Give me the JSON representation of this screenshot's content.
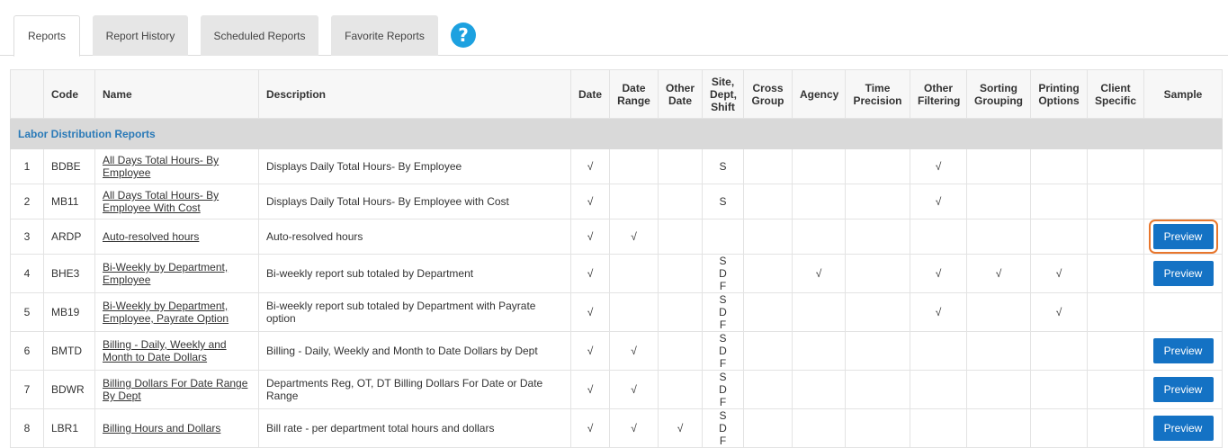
{
  "tabs": [
    {
      "label": "Reports",
      "active": true
    },
    {
      "label": "Report History"
    },
    {
      "label": "Scheduled Reports"
    },
    {
      "label": "Favorite Reports"
    }
  ],
  "help_icon": "?",
  "table": {
    "headers": {
      "num": "",
      "code": "Code",
      "name": "Name",
      "description": "Description",
      "date": "Date",
      "date_range": "Date Range",
      "other_date": "Other Date",
      "site_dept_shift": "Site, Dept, Shift",
      "cross_group": "Cross Group",
      "agency": "Agency",
      "time_precision": "Time Precision",
      "other_filtering": "Other Filtering",
      "sorting_grouping": "Sorting Grouping",
      "printing_options": "Printing Options",
      "client_specific": "Client Specific",
      "sample": "Sample"
    },
    "group_label": "Labor Distribution Reports",
    "preview_label": "Preview",
    "rows": [
      {
        "num": "1",
        "code": "BDBE",
        "name": "All Days Total Hours- By Employee",
        "description": "Displays Daily Total Hours- By Employee",
        "date": "√",
        "date_range": "",
        "other_date": "",
        "sds": "S",
        "cross_group": "",
        "agency": "",
        "time_precision": "",
        "other_filtering": "√",
        "sorting_grouping": "",
        "printing_options": "",
        "client_specific": "",
        "preview": false
      },
      {
        "num": "2",
        "code": "MB11",
        "name": "All Days Total Hours- By Employee With Cost",
        "description": "Displays Daily Total Hours- By Employee with Cost",
        "date": "√",
        "date_range": "",
        "other_date": "",
        "sds": "S",
        "cross_group": "",
        "agency": "",
        "time_precision": "",
        "other_filtering": "√",
        "sorting_grouping": "",
        "printing_options": "",
        "client_specific": "",
        "preview": false
      },
      {
        "num": "3",
        "code": "ARDP",
        "name": "Auto-resolved hours",
        "description": "Auto-resolved hours",
        "date": "√",
        "date_range": "√",
        "other_date": "",
        "sds": "",
        "cross_group": "",
        "agency": "",
        "time_precision": "",
        "other_filtering": "",
        "sorting_grouping": "",
        "printing_options": "",
        "client_specific": "",
        "preview": true,
        "focused": true
      },
      {
        "num": "4",
        "code": "BHE3",
        "name": "Bi-Weekly by Department, Employee",
        "description": "Bi-weekly report sub totaled by Department",
        "date": "√",
        "date_range": "",
        "other_date": "",
        "sds": "S D F",
        "cross_group": "",
        "agency": "√",
        "time_precision": "",
        "other_filtering": "√",
        "sorting_grouping": "√",
        "printing_options": "√",
        "client_specific": "",
        "preview": true
      },
      {
        "num": "5",
        "code": "MB19",
        "name": "Bi-Weekly by Department, Employee, Payrate Option",
        "description": "Bi-weekly report sub totaled by Department with Payrate option",
        "date": "√",
        "date_range": "",
        "other_date": "",
        "sds": "S D F",
        "cross_group": "",
        "agency": "",
        "time_precision": "",
        "other_filtering": "√",
        "sorting_grouping": "",
        "printing_options": "√",
        "client_specific": "",
        "preview": false
      },
      {
        "num": "6",
        "code": "BMTD",
        "name": "Billing - Daily, Weekly and Month to Date Dollars",
        "description": "Billing - Daily, Weekly and Month to Date Dollars by Dept",
        "date": "√",
        "date_range": "√",
        "other_date": "",
        "sds": "S D F",
        "cross_group": "",
        "agency": "",
        "time_precision": "",
        "other_filtering": "",
        "sorting_grouping": "",
        "printing_options": "",
        "client_specific": "",
        "preview": true
      },
      {
        "num": "7",
        "code": "BDWR",
        "name": "Billing Dollars For Date Range By Dept",
        "description": "Departments Reg, OT, DT Billing Dollars For Date or Date Range",
        "date": "√",
        "date_range": "√",
        "other_date": "",
        "sds": "S D F",
        "cross_group": "",
        "agency": "",
        "time_precision": "",
        "other_filtering": "",
        "sorting_grouping": "",
        "printing_options": "",
        "client_specific": "",
        "preview": true
      },
      {
        "num": "8",
        "code": "LBR1",
        "name": "Billing Hours and Dollars",
        "description": "Bill rate - per department total hours and dollars",
        "date": "√",
        "date_range": "√",
        "other_date": "√",
        "sds": "S D F",
        "cross_group": "",
        "agency": "",
        "time_precision": "",
        "other_filtering": "",
        "sorting_grouping": "",
        "printing_options": "",
        "client_specific": "",
        "preview": true
      }
    ]
  }
}
